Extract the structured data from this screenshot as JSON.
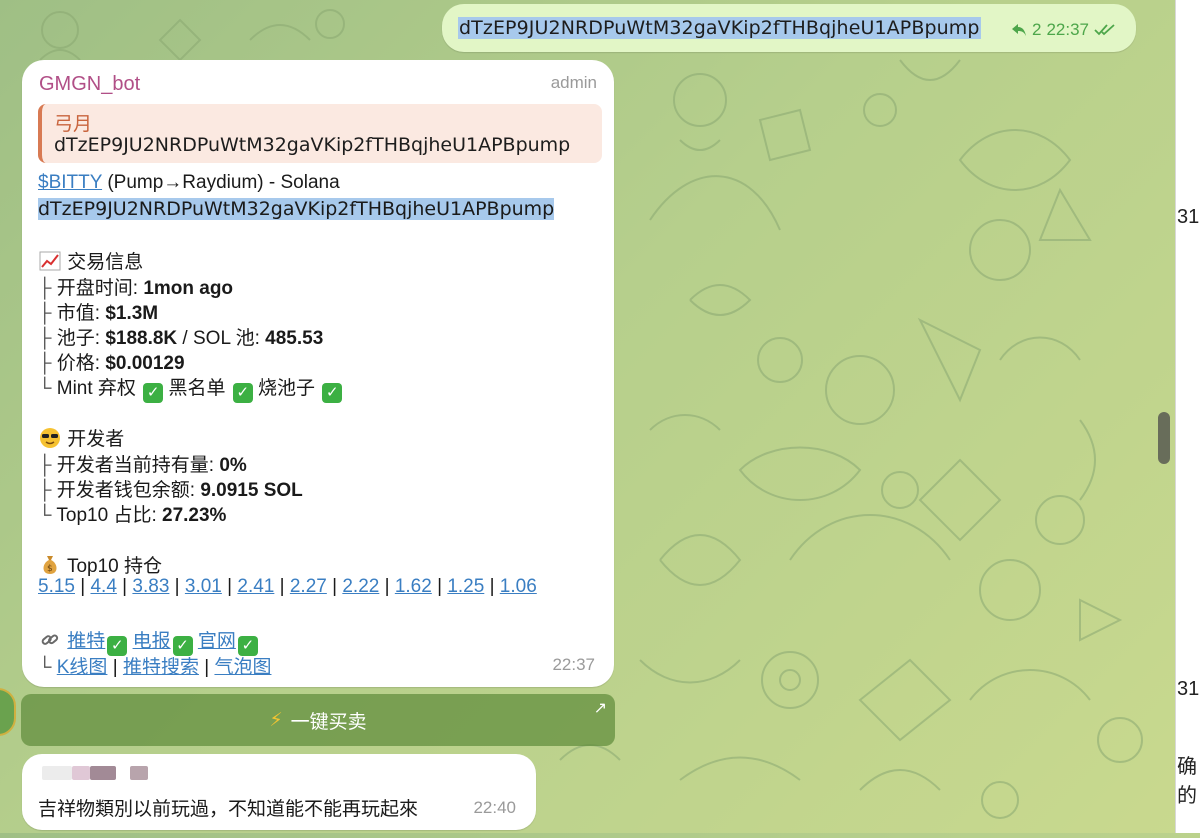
{
  "colors": {
    "outgoing_bubble": "#e2f6c6",
    "incoming_bubble": "#ffffff",
    "link": "#3a7ec2",
    "selection": "#a7c9ec",
    "sender_name": "#b14f87",
    "reply_accent": "#d87a53",
    "read_check": "#4da64a"
  },
  "outgoing_message": {
    "text": "dTzEP9JU2NRDPuWtM32gaVKip2fTHBqjheU1APBpump",
    "reply_count": "2",
    "time": "22:37",
    "status_icon": "double-check-icon"
  },
  "bot_message": {
    "sender": "GMGN_bot",
    "role": "admin",
    "reply": {
      "name": "弓月",
      "text": "dTzEP9JU2NRDPuWtM32gaVKip2fTHBqjheU1APBpump"
    },
    "token_ticker": "$BITTY",
    "token_route": " (Pump→Raydium) - Solana",
    "contract": "dTzEP9JU2NRDPuWtM32gaVKip2fTHBqjheU1APBpump",
    "trade_section": {
      "icon": "chart-increasing-icon",
      "title": "交易信息",
      "open_label": "开盘时间: ",
      "open_value": "1mon ago",
      "mcap_label": "市值: ",
      "mcap_value": "$1.3M",
      "pool_label": "池子: ",
      "pool_value": "$188.8K",
      "sol_pool_label": " / SOL 池: ",
      "sol_pool_value": "485.53",
      "price_label": "价格: ",
      "price_value": "$0.00129",
      "mint_label": "Mint 弃权 ",
      "blacklist_label": " 黑名单 ",
      "burn_label": " 烧池子 "
    },
    "dev_section": {
      "icon": "sunglasses-face-icon",
      "title": "开发者",
      "holding_label": "开发者当前持有量: ",
      "holding_value": "0%",
      "balance_label": "开发者钱包余额: ",
      "balance_value": "9.0915 SOL",
      "top10_label": "Top10 占比: ",
      "top10_value": "27.23%"
    },
    "top10_section": {
      "icon": "money-bag-icon",
      "title": "Top10 持仓",
      "holdings": [
        "5.15",
        "4.4",
        "3.83",
        "3.01",
        "2.41",
        "2.27",
        "2.22",
        "1.62",
        "1.25",
        "1.06"
      ]
    },
    "links": {
      "icon": "link-icon",
      "twitter": "推特",
      "telegram": "电报",
      "website": "官网",
      "kline": "K线图",
      "twitter_search": "推特搜索",
      "bubble_map": "气泡图"
    },
    "time": "22:37"
  },
  "keyboard_button": {
    "icon": "lightning-icon",
    "label": "一键买卖",
    "corner_icon": "arrow-up-right-icon"
  },
  "user_message": {
    "text": "吉祥物類別以前玩過，不知道能不能再玩起來",
    "time": "22:40"
  },
  "side_fragments": [
    "31",
    "31",
    "确的"
  ]
}
